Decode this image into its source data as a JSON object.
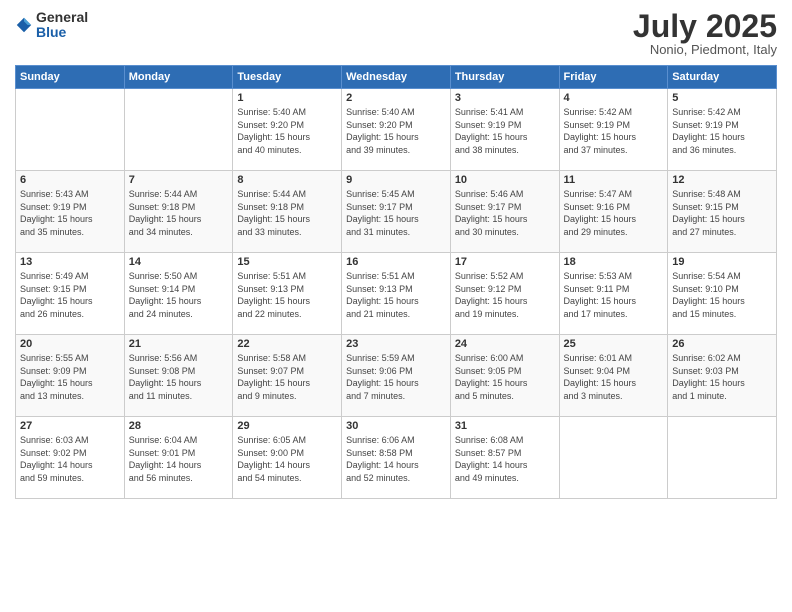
{
  "header": {
    "logo_general": "General",
    "logo_blue": "Blue",
    "title": "July 2025",
    "location": "Nonio, Piedmont, Italy"
  },
  "days_of_week": [
    "Sunday",
    "Monday",
    "Tuesday",
    "Wednesday",
    "Thursday",
    "Friday",
    "Saturday"
  ],
  "weeks": [
    [
      {
        "day": "",
        "info": ""
      },
      {
        "day": "",
        "info": ""
      },
      {
        "day": "1",
        "info": "Sunrise: 5:40 AM\nSunset: 9:20 PM\nDaylight: 15 hours\nand 40 minutes."
      },
      {
        "day": "2",
        "info": "Sunrise: 5:40 AM\nSunset: 9:20 PM\nDaylight: 15 hours\nand 39 minutes."
      },
      {
        "day": "3",
        "info": "Sunrise: 5:41 AM\nSunset: 9:19 PM\nDaylight: 15 hours\nand 38 minutes."
      },
      {
        "day": "4",
        "info": "Sunrise: 5:42 AM\nSunset: 9:19 PM\nDaylight: 15 hours\nand 37 minutes."
      },
      {
        "day": "5",
        "info": "Sunrise: 5:42 AM\nSunset: 9:19 PM\nDaylight: 15 hours\nand 36 minutes."
      }
    ],
    [
      {
        "day": "6",
        "info": "Sunrise: 5:43 AM\nSunset: 9:19 PM\nDaylight: 15 hours\nand 35 minutes."
      },
      {
        "day": "7",
        "info": "Sunrise: 5:44 AM\nSunset: 9:18 PM\nDaylight: 15 hours\nand 34 minutes."
      },
      {
        "day": "8",
        "info": "Sunrise: 5:44 AM\nSunset: 9:18 PM\nDaylight: 15 hours\nand 33 minutes."
      },
      {
        "day": "9",
        "info": "Sunrise: 5:45 AM\nSunset: 9:17 PM\nDaylight: 15 hours\nand 31 minutes."
      },
      {
        "day": "10",
        "info": "Sunrise: 5:46 AM\nSunset: 9:17 PM\nDaylight: 15 hours\nand 30 minutes."
      },
      {
        "day": "11",
        "info": "Sunrise: 5:47 AM\nSunset: 9:16 PM\nDaylight: 15 hours\nand 29 minutes."
      },
      {
        "day": "12",
        "info": "Sunrise: 5:48 AM\nSunset: 9:15 PM\nDaylight: 15 hours\nand 27 minutes."
      }
    ],
    [
      {
        "day": "13",
        "info": "Sunrise: 5:49 AM\nSunset: 9:15 PM\nDaylight: 15 hours\nand 26 minutes."
      },
      {
        "day": "14",
        "info": "Sunrise: 5:50 AM\nSunset: 9:14 PM\nDaylight: 15 hours\nand 24 minutes."
      },
      {
        "day": "15",
        "info": "Sunrise: 5:51 AM\nSunset: 9:13 PM\nDaylight: 15 hours\nand 22 minutes."
      },
      {
        "day": "16",
        "info": "Sunrise: 5:51 AM\nSunset: 9:13 PM\nDaylight: 15 hours\nand 21 minutes."
      },
      {
        "day": "17",
        "info": "Sunrise: 5:52 AM\nSunset: 9:12 PM\nDaylight: 15 hours\nand 19 minutes."
      },
      {
        "day": "18",
        "info": "Sunrise: 5:53 AM\nSunset: 9:11 PM\nDaylight: 15 hours\nand 17 minutes."
      },
      {
        "day": "19",
        "info": "Sunrise: 5:54 AM\nSunset: 9:10 PM\nDaylight: 15 hours\nand 15 minutes."
      }
    ],
    [
      {
        "day": "20",
        "info": "Sunrise: 5:55 AM\nSunset: 9:09 PM\nDaylight: 15 hours\nand 13 minutes."
      },
      {
        "day": "21",
        "info": "Sunrise: 5:56 AM\nSunset: 9:08 PM\nDaylight: 15 hours\nand 11 minutes."
      },
      {
        "day": "22",
        "info": "Sunrise: 5:58 AM\nSunset: 9:07 PM\nDaylight: 15 hours\nand 9 minutes."
      },
      {
        "day": "23",
        "info": "Sunrise: 5:59 AM\nSunset: 9:06 PM\nDaylight: 15 hours\nand 7 minutes."
      },
      {
        "day": "24",
        "info": "Sunrise: 6:00 AM\nSunset: 9:05 PM\nDaylight: 15 hours\nand 5 minutes."
      },
      {
        "day": "25",
        "info": "Sunrise: 6:01 AM\nSunset: 9:04 PM\nDaylight: 15 hours\nand 3 minutes."
      },
      {
        "day": "26",
        "info": "Sunrise: 6:02 AM\nSunset: 9:03 PM\nDaylight: 15 hours\nand 1 minute."
      }
    ],
    [
      {
        "day": "27",
        "info": "Sunrise: 6:03 AM\nSunset: 9:02 PM\nDaylight: 14 hours\nand 59 minutes."
      },
      {
        "day": "28",
        "info": "Sunrise: 6:04 AM\nSunset: 9:01 PM\nDaylight: 14 hours\nand 56 minutes."
      },
      {
        "day": "29",
        "info": "Sunrise: 6:05 AM\nSunset: 9:00 PM\nDaylight: 14 hours\nand 54 minutes."
      },
      {
        "day": "30",
        "info": "Sunrise: 6:06 AM\nSunset: 8:58 PM\nDaylight: 14 hours\nand 52 minutes."
      },
      {
        "day": "31",
        "info": "Sunrise: 6:08 AM\nSunset: 8:57 PM\nDaylight: 14 hours\nand 49 minutes."
      },
      {
        "day": "",
        "info": ""
      },
      {
        "day": "",
        "info": ""
      }
    ]
  ]
}
